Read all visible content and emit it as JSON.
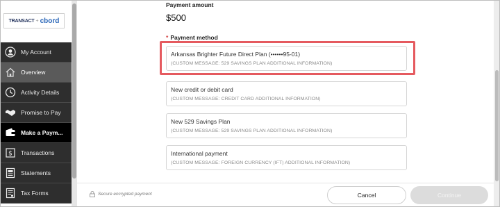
{
  "logo": {
    "brand1": "TRANSACT",
    "plus": "+",
    "brand2": "cbord"
  },
  "sidebar": {
    "items": [
      {
        "label": "My Account",
        "icon": "user-icon"
      },
      {
        "label": "Overview",
        "icon": "home-icon"
      },
      {
        "label": "Activity Details",
        "icon": "clock-icon"
      },
      {
        "label": "Promise to Pay",
        "icon": "handshake-icon"
      },
      {
        "label": "Make a Paym...",
        "icon": "wallet-icon"
      },
      {
        "label": "Transactions",
        "icon": "dollar-document-icon"
      },
      {
        "label": "Statements",
        "icon": "statement-icon"
      },
      {
        "label": "Tax Forms",
        "icon": "tax-form-icon"
      }
    ]
  },
  "payment": {
    "amount_label": "Payment amount",
    "amount_value": "$500",
    "method_required": "*",
    "method_label": "Payment method",
    "options": [
      {
        "title": "Arkansas Brighter Future Direct Plan (••••••95-01)",
        "subtitle": "(CUSTOM MESSAGE: 529 SAVINGS PLAN ADDITIONAL INFORMATION)"
      },
      {
        "title": "New credit or debit card",
        "subtitle": "(CUSTOM MESSAGE: CREDIT CARD ADDITIONAL INFORMATION)"
      },
      {
        "title": "New 529 Savings Plan",
        "subtitle": "(CUSTOM MESSAGE: 529 SAVINGS PLAN ADDITIONAL INFORMATION)"
      },
      {
        "title": "International payment",
        "subtitle": "(CUSTOM MESSAGE: FOREIGN CURRENCY (IFT) ADDITIONAL INFORMATION)"
      }
    ]
  },
  "footer": {
    "secure_text": "Secure encrypted payment",
    "cancel_label": "Cancel",
    "continue_label": "Continue"
  },
  "colors": {
    "highlight": "#e55a5f",
    "sidebar_bg": "#3d3d3d",
    "sidebar_active": "#000000",
    "required": "#d23b3b"
  }
}
